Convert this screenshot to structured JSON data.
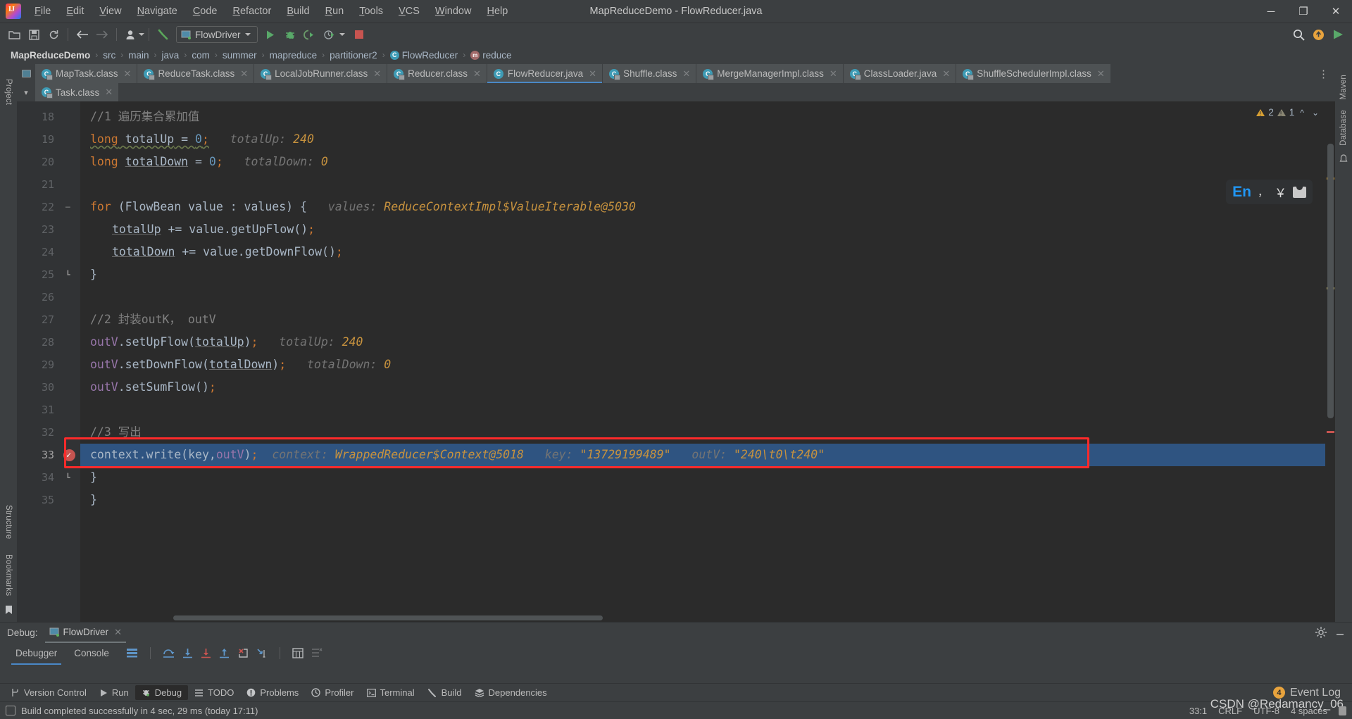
{
  "window": {
    "title": "MapReduceDemo - FlowReducer.java",
    "minimize_label": "─",
    "maximize_label": "❐",
    "close_label": "✕"
  },
  "menu": [
    {
      "label": "File"
    },
    {
      "label": "Edit"
    },
    {
      "label": "View"
    },
    {
      "label": "Navigate"
    },
    {
      "label": "Code"
    },
    {
      "label": "Refactor"
    },
    {
      "label": "Build"
    },
    {
      "label": "Run"
    },
    {
      "label": "Tools"
    },
    {
      "label": "VCS"
    },
    {
      "label": "Window"
    },
    {
      "label": "Help"
    }
  ],
  "toolbar": {
    "open_icon": "folder-open-icon",
    "save_icon": "save-icon",
    "sync_icon": "sync-icon",
    "back_icon": "back-arrow-icon",
    "forward_icon": "forward-arrow-icon",
    "profile_icon": "user-profile-icon",
    "build_icon": "hammer-icon",
    "run_config": "FlowDriver",
    "run_icon": "run-icon",
    "debug_icon": "debug-bug-icon",
    "run_coverage_icon": "run-with-coverage-icon",
    "profile_run_icon": "profiler-run-icon",
    "stop_icon": "stop-icon",
    "search_icon": "search-icon",
    "update_icon": "update-badge-icon",
    "share_icon": "share-icon"
  },
  "breadcrumb": [
    {
      "label": "MapReduceDemo",
      "bold": true,
      "icon": ""
    },
    {
      "label": "src",
      "bold": false,
      "icon": ""
    },
    {
      "label": "main",
      "bold": false,
      "icon": ""
    },
    {
      "label": "java",
      "bold": false,
      "icon": ""
    },
    {
      "label": "com",
      "bold": false,
      "icon": ""
    },
    {
      "label": "summer",
      "bold": false,
      "icon": ""
    },
    {
      "label": "mapreduce",
      "bold": false,
      "icon": ""
    },
    {
      "label": "partitioner2",
      "bold": false,
      "icon": ""
    },
    {
      "label": "FlowReducer",
      "bold": false,
      "icon": "class-icon"
    },
    {
      "label": "reduce",
      "bold": false,
      "icon": "method-icon"
    }
  ],
  "tabs_row1": [
    {
      "label": "MapTask.class",
      "active": false,
      "locked": true
    },
    {
      "label": "ReduceTask.class",
      "active": false,
      "locked": true
    },
    {
      "label": "LocalJobRunner.class",
      "active": false,
      "locked": true
    },
    {
      "label": "Reducer.class",
      "active": false,
      "locked": true
    },
    {
      "label": "FlowReducer.java",
      "active": true,
      "locked": false
    },
    {
      "label": "Shuffle.class",
      "active": false,
      "locked": true
    },
    {
      "label": "MergeManagerImpl.class",
      "active": false,
      "locked": true
    },
    {
      "label": "ClassLoader.java",
      "active": false,
      "locked": true
    },
    {
      "label": "ShuffleSchedulerImpl.class",
      "active": false,
      "locked": true
    }
  ],
  "tabs_row2": [
    {
      "label": "Task.class",
      "active": false,
      "locked": true
    }
  ],
  "tabs_overflow_icon": "more-tabs-icon",
  "left_rail": {
    "project_label": "Project",
    "structure_label": "Structure",
    "bookmarks_label": "Bookmarks"
  },
  "right_rail": {
    "maven_label": "Maven",
    "database_label": "Database",
    "notifications_label": "Notifications"
  },
  "inspections": {
    "warning_count": "2",
    "weak_warning_count": "1",
    "up_icon": "chevron-up-icon",
    "down_icon": "chevron-down-icon"
  },
  "ime": {
    "lang": "En",
    "punct": "，",
    "currency": "￥",
    "skin_icon": "tshirt-icon"
  },
  "editor": {
    "lines": [
      {
        "num": "18",
        "indent": 0,
        "tokens": [
          {
            "t": "//1 遍历集合累加值",
            "c": "cmt"
          }
        ]
      },
      {
        "num": "19",
        "indent": 0,
        "tokens": [
          {
            "t": "long",
            "c": "kw wavy"
          },
          {
            "t": " ",
            "c": "wavy"
          },
          {
            "t": "totalUp",
            "c": "var-u wavy"
          },
          {
            "t": " = ",
            "c": "wavy"
          },
          {
            "t": "0",
            "c": "num wavy"
          },
          {
            "t": ";",
            "c": "kw wavy"
          },
          {
            "t": "   ",
            "c": ""
          },
          {
            "t": "totalUp: ",
            "c": "hint"
          },
          {
            "t": "240",
            "c": "hintval"
          }
        ]
      },
      {
        "num": "20",
        "indent": 0,
        "tokens": [
          {
            "t": "long",
            "c": "kw"
          },
          {
            "t": " ",
            "c": ""
          },
          {
            "t": "totalDown",
            "c": "var-u"
          },
          {
            "t": " = ",
            "c": ""
          },
          {
            "t": "0",
            "c": "num"
          },
          {
            "t": ";",
            "c": "kw"
          },
          {
            "t": "   ",
            "c": ""
          },
          {
            "t": "totalDown: ",
            "c": "hint"
          },
          {
            "t": "0",
            "c": "hintval"
          }
        ]
      },
      {
        "num": "21",
        "indent": 0,
        "tokens": []
      },
      {
        "num": "22",
        "indent": 0,
        "tokens": [
          {
            "t": "for",
            "c": "kw"
          },
          {
            "t": " (FlowBean value : values) {",
            "c": ""
          },
          {
            "t": "   ",
            "c": ""
          },
          {
            "t": "values: ",
            "c": "hint"
          },
          {
            "t": "ReduceContextImpl$ValueIterable@5030",
            "c": "hintval"
          }
        ]
      },
      {
        "num": "23",
        "indent": 1,
        "tokens": [
          {
            "t": "totalUp",
            "c": "var-u"
          },
          {
            "t": " += value.getUpFlow()",
            "c": ""
          },
          {
            "t": ";",
            "c": "kw"
          }
        ]
      },
      {
        "num": "24",
        "indent": 1,
        "tokens": [
          {
            "t": "totalDown",
            "c": "var-u"
          },
          {
            "t": " += value.getDownFlow()",
            "c": ""
          },
          {
            "t": ";",
            "c": "kw"
          }
        ]
      },
      {
        "num": "25",
        "indent": 0,
        "tokens": [
          {
            "t": "}",
            "c": ""
          }
        ]
      },
      {
        "num": "26",
        "indent": 0,
        "tokens": []
      },
      {
        "num": "27",
        "indent": 0,
        "tokens": [
          {
            "t": "//2 封装outK， outV",
            "c": "cmt"
          }
        ]
      },
      {
        "num": "28",
        "indent": 0,
        "tokens": [
          {
            "t": "outV",
            "c": "fld"
          },
          {
            "t": ".setUpFlow(",
            "c": ""
          },
          {
            "t": "totalUp",
            "c": "var-u"
          },
          {
            "t": ")",
            "c": ""
          },
          {
            "t": ";",
            "c": "kw"
          },
          {
            "t": "   ",
            "c": ""
          },
          {
            "t": "totalUp: ",
            "c": "hint"
          },
          {
            "t": "240",
            "c": "hintval"
          }
        ]
      },
      {
        "num": "29",
        "indent": 0,
        "tokens": [
          {
            "t": "outV",
            "c": "fld"
          },
          {
            "t": ".setDownFlow(",
            "c": ""
          },
          {
            "t": "totalDown",
            "c": "var-u"
          },
          {
            "t": ")",
            "c": ""
          },
          {
            "t": ";",
            "c": "kw"
          },
          {
            "t": "   ",
            "c": ""
          },
          {
            "t": "totalDown: ",
            "c": "hint"
          },
          {
            "t": "0",
            "c": "hintval"
          }
        ]
      },
      {
        "num": "30",
        "indent": 0,
        "tokens": [
          {
            "t": "outV",
            "c": "fld"
          },
          {
            "t": ".setSumFlow()",
            "c": ""
          },
          {
            "t": ";",
            "c": "kw"
          }
        ]
      },
      {
        "num": "31",
        "indent": 0,
        "tokens": []
      },
      {
        "num": "32",
        "indent": 0,
        "tokens": [
          {
            "t": "//3 写出",
            "c": "cmt"
          }
        ]
      },
      {
        "num": "33",
        "indent": 0,
        "highlight": true,
        "breakpoint": true,
        "tokens": [
          {
            "t": "context",
            "c": ""
          },
          {
            "t": ".write(key,",
            "c": ""
          },
          {
            "t": "outV",
            "c": "fld"
          },
          {
            "t": ")",
            "c": ""
          },
          {
            "t": ";",
            "c": "kw"
          },
          {
            "t": "  ",
            "c": ""
          },
          {
            "t": "context: ",
            "c": "hint"
          },
          {
            "t": "WrappedReducer$Context@5018",
            "c": "hintval"
          },
          {
            "t": "   ",
            "c": ""
          },
          {
            "t": "key: ",
            "c": "hint"
          },
          {
            "t": "\"13729199489\"",
            "c": "hintval"
          },
          {
            "t": "   ",
            "c": ""
          },
          {
            "t": "outV: ",
            "c": "hint"
          },
          {
            "t": "\"240\\t0\\t240\"",
            "c": "hintval"
          }
        ]
      },
      {
        "num": "34",
        "indent": 0,
        "tokens": [
          {
            "t": "}",
            "c": ""
          }
        ]
      },
      {
        "num": "35",
        "indent": 0,
        "tokens": [
          {
            "t": "}",
            "c": ""
          }
        ]
      }
    ]
  },
  "debug_panel": {
    "title": "Debug:",
    "session_tab": "FlowDriver",
    "session_close": "✕",
    "subtabs": [
      {
        "label": "Debugger",
        "active": true
      },
      {
        "label": "Console",
        "active": false
      }
    ],
    "icons": [
      "layout-icon",
      "step-over-icon",
      "step-into-icon",
      "force-step-into-icon",
      "step-out-icon",
      "drop-frame-icon",
      "run-to-cursor-icon",
      "evaluate-expression-icon",
      "mute-breakpoints-icon"
    ],
    "settings_icon": "gear-icon",
    "minimize_icon": "minimize-icon"
  },
  "toolwindow_bar": {
    "items": [
      {
        "label": "Version Control",
        "icon": "branch-icon",
        "active": false
      },
      {
        "label": "Run",
        "icon": "run-icon",
        "active": false
      },
      {
        "label": "Debug",
        "icon": "debug-bug-icon",
        "active": true
      },
      {
        "label": "TODO",
        "icon": "todo-list-icon",
        "active": false
      },
      {
        "label": "Problems",
        "icon": "problems-icon",
        "active": false
      },
      {
        "label": "Profiler",
        "icon": "profiler-icon",
        "active": false
      },
      {
        "label": "Terminal",
        "icon": "terminal-icon",
        "active": false
      },
      {
        "label": "Build",
        "icon": "hammer-icon",
        "active": false
      },
      {
        "label": "Dependencies",
        "icon": "dependencies-icon",
        "active": false
      }
    ],
    "event_log": "Event Log",
    "event_log_count": "4"
  },
  "status_bar": {
    "message": "Build completed successfully in 4 sec, 29 ms (today 17:11)",
    "caret_position": "33:1",
    "line_separator": "CRLF",
    "encoding": "UTF-8",
    "indent": "4 spaces",
    "lock_icon": "read-only-lock-icon",
    "watermark": "CSDN @Redamancy_06"
  }
}
